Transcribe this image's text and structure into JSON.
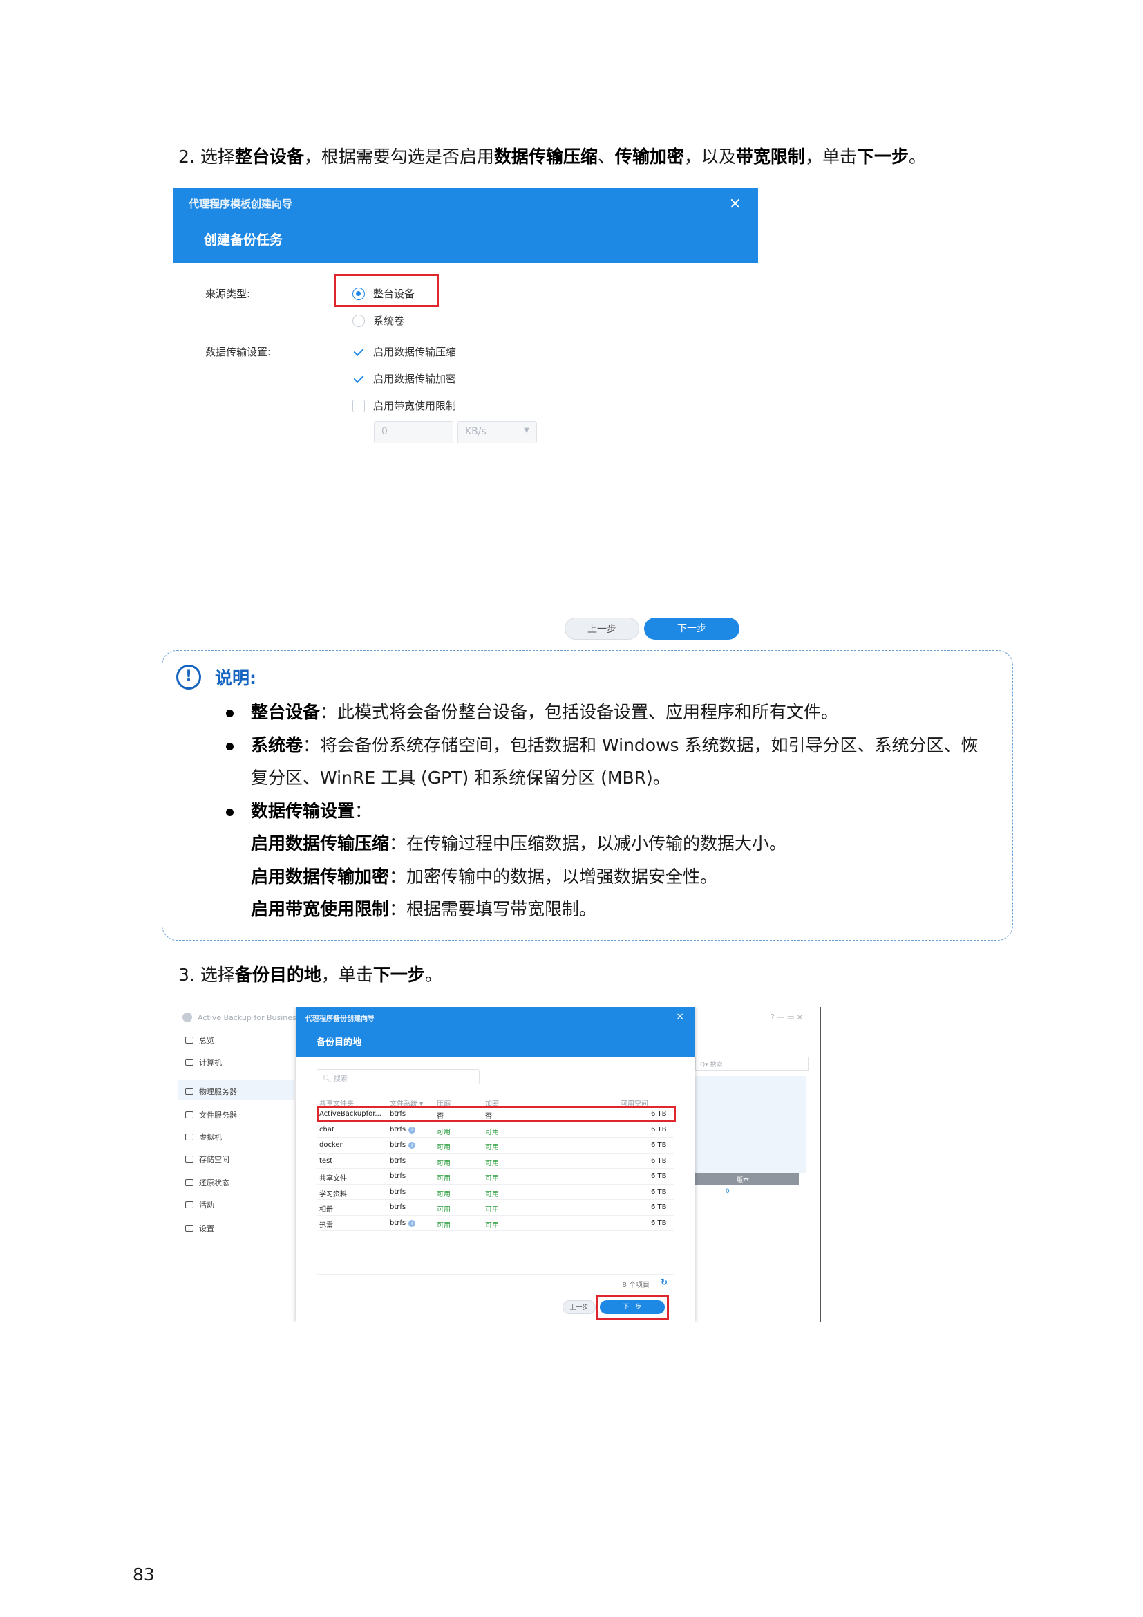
{
  "step2": {
    "num": "2.",
    "t1": "选择",
    "b1": "整台设备",
    "t2": "，根据需要勾选是否启用",
    "b2": "数据传输压缩",
    "t3": "、",
    "b3": "传输加密",
    "t4": "，以及",
    "b4": "带宽限制",
    "t5": "，单击",
    "b5": "下一步",
    "t6": "。"
  },
  "dialog1": {
    "wizard_title": "代理程序模板创建向导",
    "title": "创建备份任务",
    "close": "×",
    "source_label": "来源类型:",
    "source_options": [
      "整台设备",
      "系统卷"
    ],
    "transfer_label": "数据传输设置:",
    "transfer_options": [
      "启用数据传输压缩",
      "启用数据传输加密",
      "启用带宽使用限制"
    ],
    "bandwidth_value": "0",
    "bandwidth_unit": "KB/s",
    "prev_button": "上一步",
    "next_button": "下一步"
  },
  "note": {
    "icon": "!",
    "title": "说明:",
    "items": [
      {
        "term": "整台设备",
        "text": "：此模式将会备份整台设备，包括设备设置、应用程序和所有文件。"
      },
      {
        "term": "系统卷",
        "text": "：将会备份系统存储空间，包括数据和 Windows 系统数据，如引导分区、系统分区、恢",
        "cont": "复分区、WinRE 工具 (GPT) 和系统保留分区 (MBR)。"
      },
      {
        "term": "数据传输设置",
        "text": "："
      }
    ],
    "subs": [
      {
        "term": "启用数据传输压缩",
        "text": "：在传输过程中压缩数据，以减小传输的数据大小。"
      },
      {
        "term": "启用数据传输加密",
        "text": "：加密传输中的数据，以增强数据安全性。"
      },
      {
        "term": "启用带宽使用限制",
        "text": "：根据需要填写带宽限制。"
      }
    ]
  },
  "step3": {
    "num": "3.",
    "t1": "选择",
    "b1": "备份目的地",
    "t2": "，单击",
    "b2": "下一步",
    "t3": "。"
  },
  "screenshot2": {
    "app_title": "Active Backup for Business",
    "window_controls": "? — ▭ ×",
    "sidebar": [
      "总览",
      "计算机",
      "物理服务器",
      "文件服务器",
      "虚拟机",
      "存储空间",
      "还原状态",
      "活动",
      "设置"
    ],
    "bg_search": "搜索",
    "bg_col": "版本",
    "bg_val": "0",
    "wizard_title": "代理程序备份创建向导",
    "title": "备份目的地",
    "close": "×",
    "search_placeholder": "搜索",
    "columns": [
      "共享文件夹",
      "文件系统 ▾",
      "压缩",
      "加密",
      "可用空间"
    ],
    "rows": [
      [
        "ActiveBackupfor...",
        "btrfs",
        "否",
        "否",
        "6 TB"
      ],
      [
        "chat",
        "btrfs",
        "可用",
        "可用",
        "6 TB"
      ],
      [
        "docker",
        "btrfs",
        "可用",
        "可用",
        "6 TB"
      ],
      [
        "test",
        "btrfs",
        "可用",
        "可用",
        "6 TB"
      ],
      [
        "共享文件",
        "btrfs",
        "可用",
        "可用",
        "6 TB"
      ],
      [
        "学习资料",
        "btrfs",
        "可用",
        "可用",
        "6 TB"
      ],
      [
        "相册",
        "btrfs",
        "可用",
        "可用",
        "6 TB"
      ],
      [
        "迅雷",
        "btrfs",
        "可用",
        "可用",
        "6 TB"
      ]
    ],
    "item_count": "8 个项目",
    "prev_button": "上一步",
    "next_button": "下一步"
  },
  "page_number": "83",
  "colors": {
    "accent": "#1e88e5",
    "highlight": "#e0262d",
    "note_border": "#6a9fd6",
    "available": "#2e9e3e"
  }
}
